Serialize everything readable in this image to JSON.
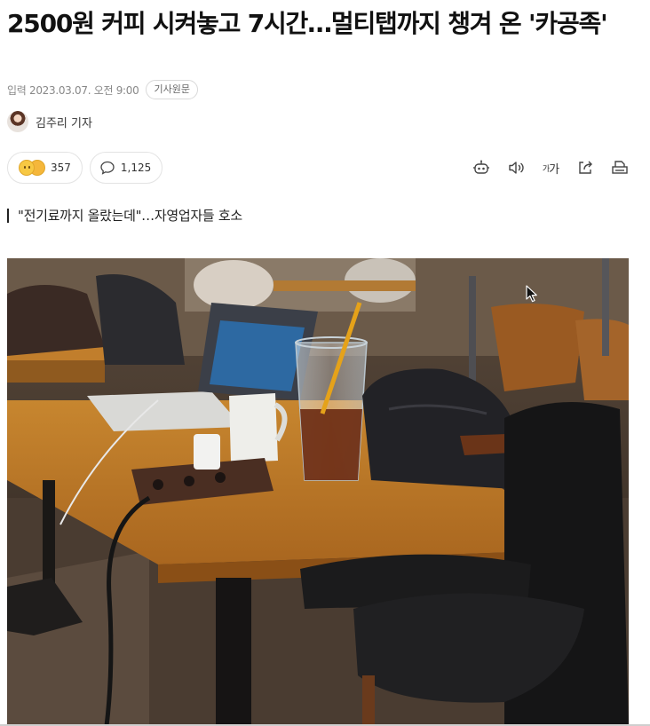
{
  "article": {
    "headline": "2500원 커피 시켜놓고 7시간…멀티탭까지 챙겨 온 '카공족'",
    "published": "입력 2023.03.07. 오전 9:00",
    "original_button": "기사원문",
    "reporter": "김주리 기자",
    "subheadline": "\"전기료까지 올랐는데\"…자영업자들 호소"
  },
  "reactions": {
    "emoji_count": "357",
    "comment_count": "1,125"
  },
  "toolbar": {
    "font_size_label": "가",
    "font_size_small": "가"
  },
  "icons": [
    "reaction-emoji-icon",
    "comment-icon",
    "robot-summary-icon",
    "speaker-icon",
    "font-size-icon",
    "share-icon",
    "print-icon"
  ],
  "colors": {
    "text": "#111111",
    "meta": "#888888",
    "border": "#e3e3e3"
  }
}
